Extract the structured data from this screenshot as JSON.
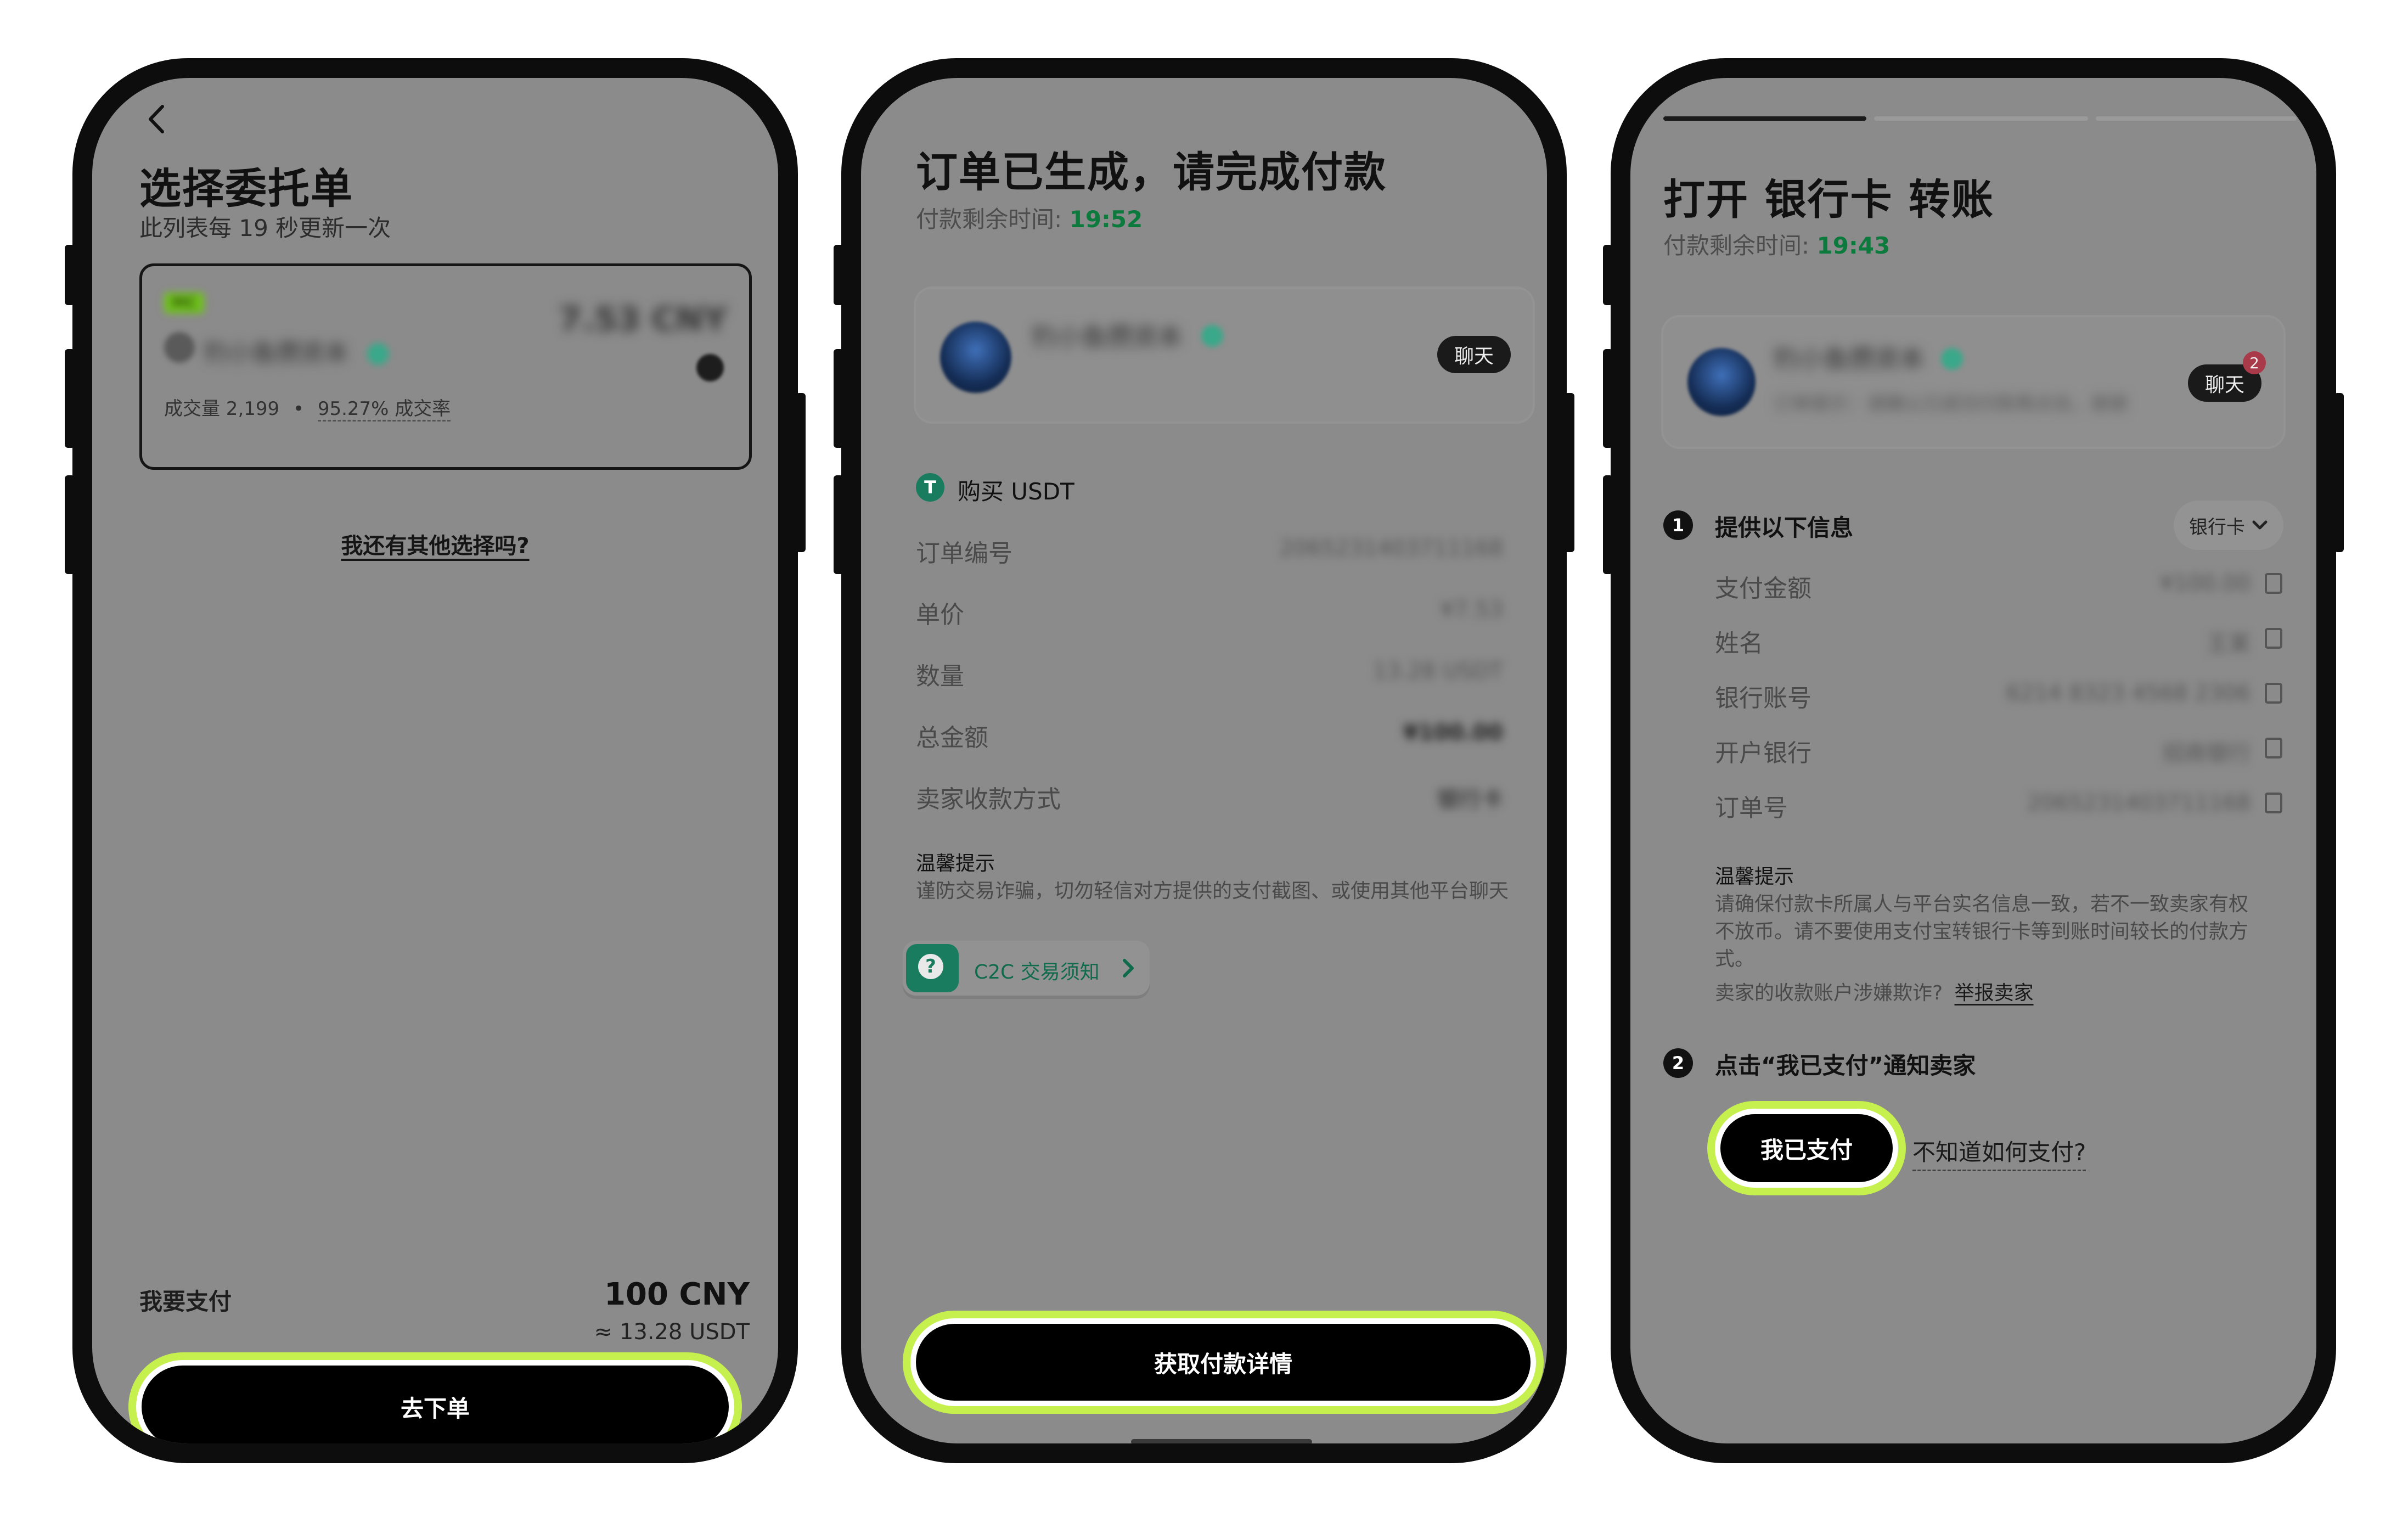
{
  "phone1": {
    "title": "选择委托单",
    "subtitle": "此列表每 19 秒更新一次",
    "offer": {
      "badge": "MC",
      "merchant": "钓小鱼攒资本",
      "price": "7.53 CNY",
      "volume": "成交量 2,199",
      "dot": "•",
      "rate": "95.27% 成交率"
    },
    "other_options": "我还有其他选择吗?",
    "pay_label": "我要支付",
    "pay_amount": "100 CNY",
    "pay_usdt": "≈ 13.28 USDT",
    "cta": "去下单"
  },
  "phone2": {
    "title": "订单已生成，请完成付款",
    "timer_label": "付款剩余时间:",
    "timer_value": "19:52",
    "merchant": "钓小鱼攒资本",
    "chat": "聊天",
    "buy_label": "购买 USDT",
    "rows": [
      {
        "label": "订单编号",
        "value": "2065231403711168"
      },
      {
        "label": "单价",
        "value": "¥7.53"
      },
      {
        "label": "数量",
        "value": "13.28 USDT"
      },
      {
        "label": "总金额",
        "value": "¥100.00"
      },
      {
        "label": "卖家收款方式",
        "value": "银行卡"
      }
    ],
    "tip_title": "温馨提示",
    "tip_text": "谨防交易诈骗，切勿轻信对方提供的支付截图、或使用其他平台聊天",
    "c2c_link": "C2C 交易须知",
    "cta": "获取付款详情"
  },
  "phone3": {
    "title": "打开 银行卡 转账",
    "timer_label": "付款剩余时间:",
    "timer_value": "19:43",
    "merchant": "钓小鱼攒资本",
    "merchant_note": "订单提示：请确认已成功付款再点击，谢谢",
    "chat": "聊天",
    "chat_badge": "2",
    "step1_num": "1",
    "step1_title": "提供以下信息",
    "method": "银行卡",
    "rows": [
      {
        "label": "支付金额",
        "value": "¥100.00"
      },
      {
        "label": "姓名",
        "value": "王某"
      },
      {
        "label": "银行账号",
        "value": "6214 8323 4568 2306"
      },
      {
        "label": "开户银行",
        "value": "招商银行"
      },
      {
        "label": "订单号",
        "value": "2065231403711168"
      }
    ],
    "tip_title": "温馨提示",
    "tip_text_1": "请确保付款卡所属人与平台实名信息一致，若不一致卖家有权",
    "tip_text_2": "不放币。请不要使用支付宝转银行卡等到账时间较长的付款方",
    "tip_text_3": "式。",
    "fraud_q": "卖家的收款账户涉嫌欺诈?",
    "report": "举报卖家",
    "step2_num": "2",
    "step2_title": "点击“我已支付”通知卖家",
    "paid_btn": "我已支付",
    "help_link": "不知道如何支付?"
  }
}
